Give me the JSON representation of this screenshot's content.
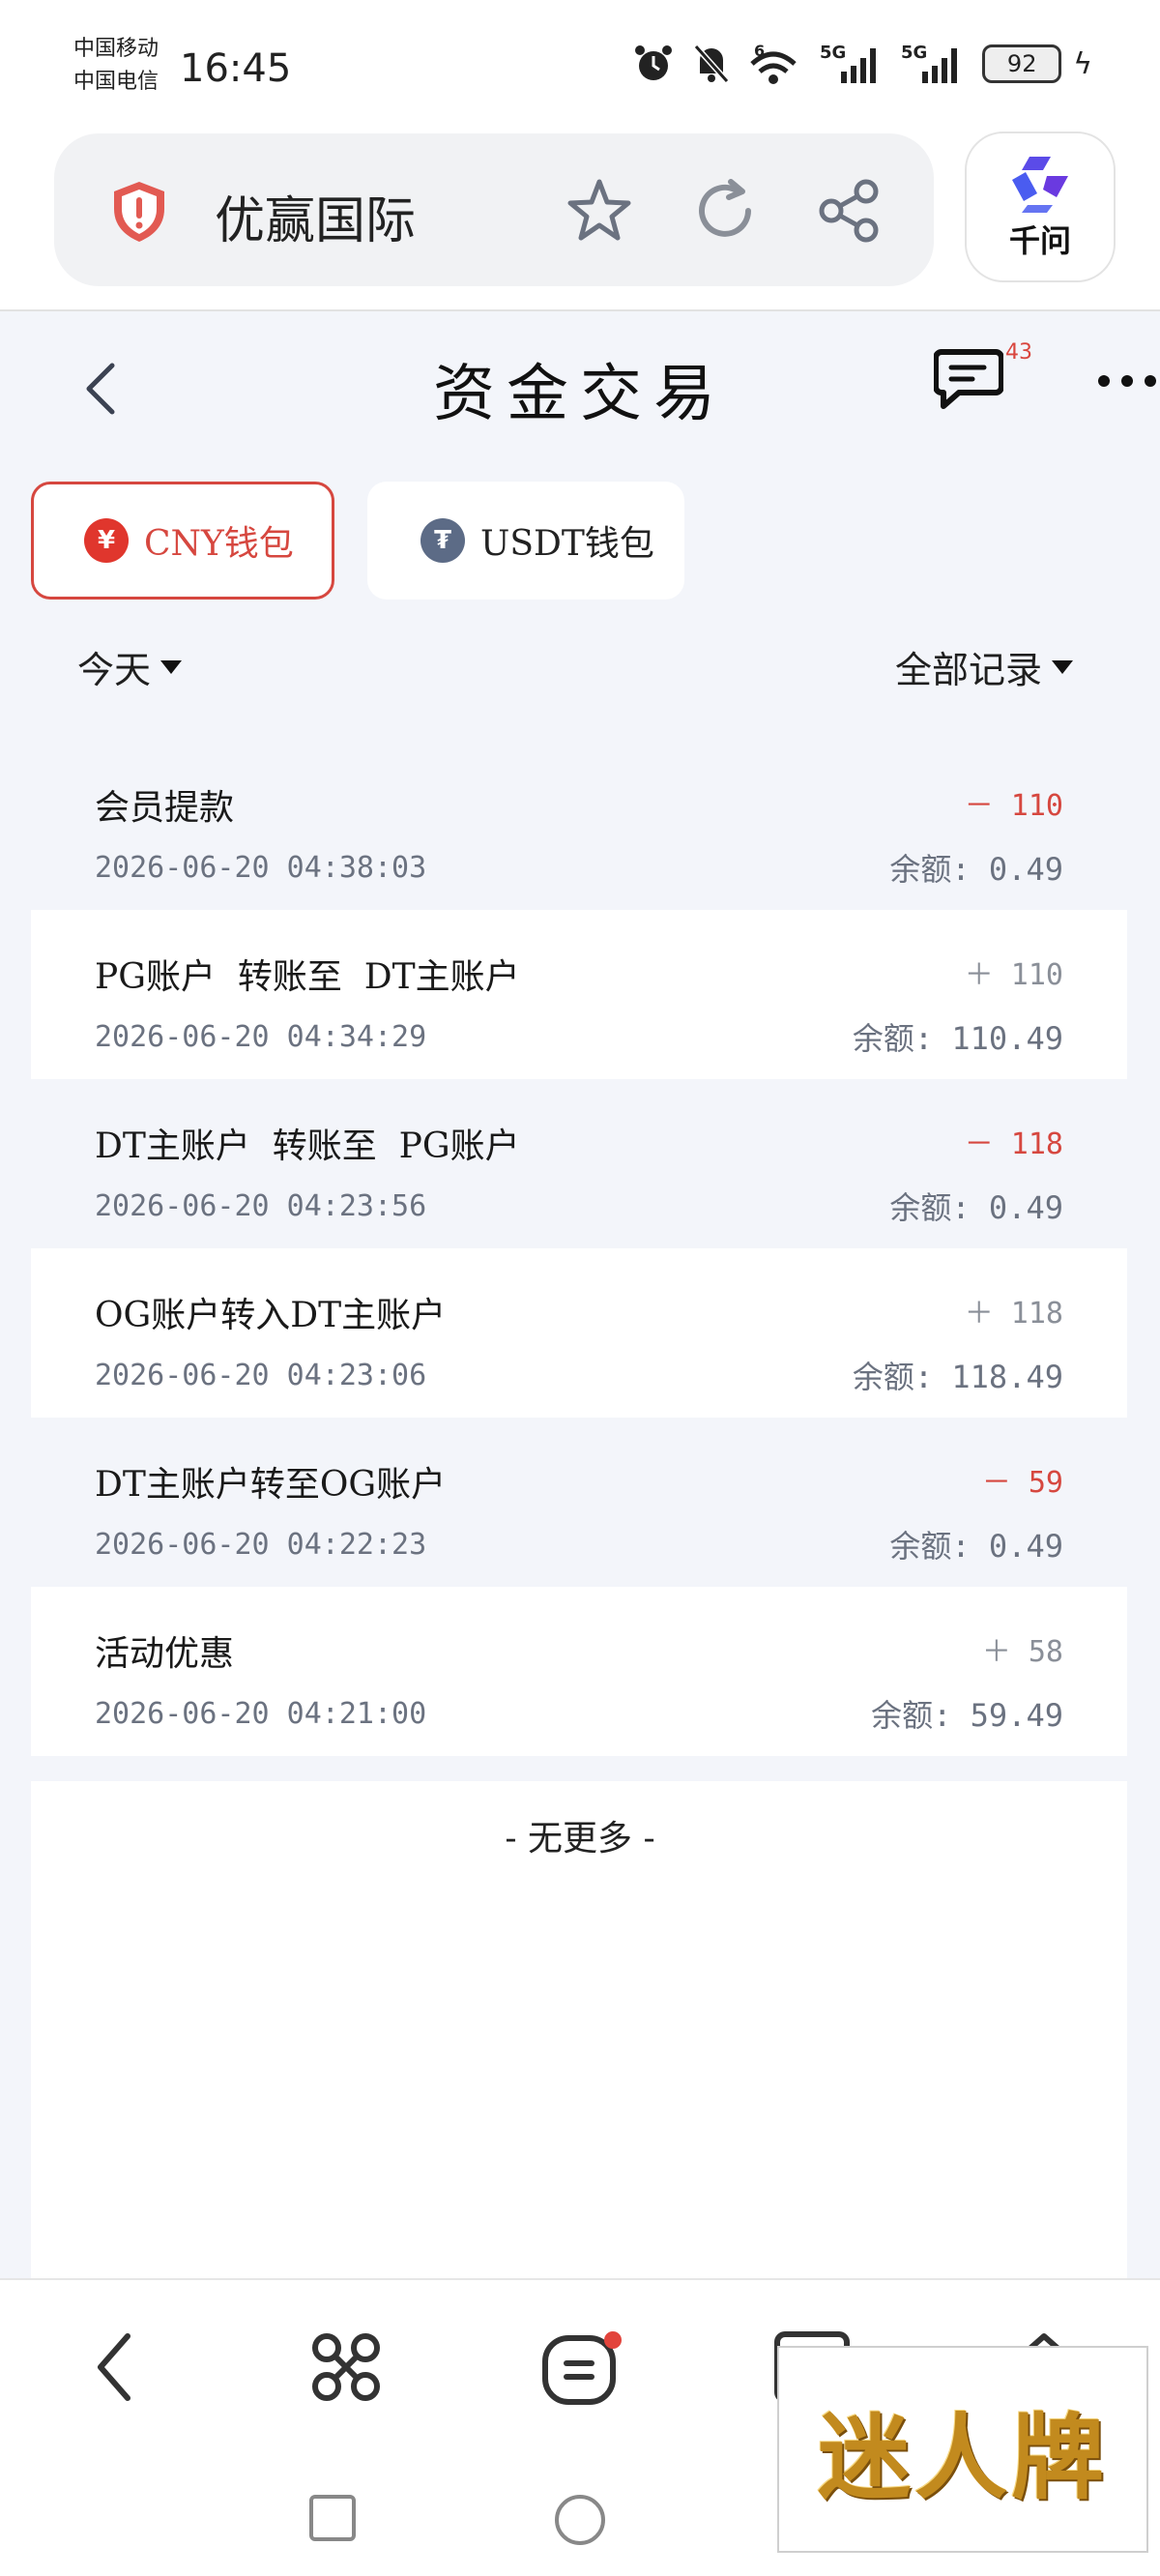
{
  "status_bar": {
    "carrier_1": "中国移动",
    "carrier_2": "中国电信",
    "time": "16:45",
    "network_1": "5G",
    "network_2": "5G",
    "wifi_label": "6",
    "battery": "92"
  },
  "browser": {
    "site_name": "优赢国际",
    "assistant_label": "千问",
    "icons": [
      "shield-icon",
      "star-icon",
      "refresh-icon",
      "share-icon",
      "qianwen-logo-icon"
    ]
  },
  "app": {
    "title": "资金交易",
    "chat_badge": "43",
    "wallet_tabs": [
      {
        "label": "CNY钱包",
        "symbol": "¥",
        "active": true
      },
      {
        "label": "USDT钱包",
        "symbol": "₮",
        "active": false
      }
    ],
    "filter_date": "今天",
    "filter_type": "全部记录",
    "records": [
      {
        "title": "会员提款",
        "time": "2026-06-20 04:38:03",
        "amount": "－ 110",
        "balance": "余额: 0.49",
        "direction": "out"
      },
      {
        "title": "PG账户  转账至  DT主账户",
        "time": "2026-06-20 04:34:29",
        "amount": "＋ 110",
        "balance": "余额: 110.49",
        "direction": "in"
      },
      {
        "title": "DT主账户  转账至  PG账户",
        "time": "2026-06-20 04:23:56",
        "amount": "－ 118",
        "balance": "余额: 0.49",
        "direction": "out"
      },
      {
        "title": "OG账户转入DT主账户",
        "time": "2026-06-20 04:23:06",
        "amount": "＋ 118",
        "balance": "余额: 118.49",
        "direction": "in"
      },
      {
        "title": "DT主账户转至OG账户",
        "time": "2026-06-20 04:22:23",
        "amount": "－ 59",
        "balance": "余额: 0.49",
        "direction": "out"
      },
      {
        "title": "活动优惠",
        "time": "2026-06-20 04:21:00",
        "amount": "＋ 58",
        "balance": "余额: 59.49",
        "direction": "in"
      }
    ],
    "end_text": "- 无更多 -"
  },
  "colors": {
    "accent_red": "#d6473f",
    "page_bg": "#f3f5fa",
    "muted_text": "#6b7280"
  },
  "watermark": "迷人牌"
}
